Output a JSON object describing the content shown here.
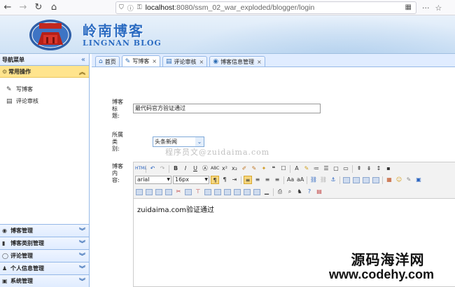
{
  "browser": {
    "url_host": "localhost",
    "url_rest": ":8080/ssm_02_war_exploded/blogger/login"
  },
  "banner": {
    "title_cn": "岭南博客",
    "title_en": "LINGNAN BLOG"
  },
  "sidebar": {
    "header": "导航菜单",
    "collapse_glyph": "«",
    "open_section": {
      "label": "常用操作",
      "items": [
        {
          "label": "写博客",
          "icon": "pencil-icon"
        },
        {
          "label": "评论审核",
          "icon": "comment-icon"
        }
      ]
    },
    "closed_sections": [
      {
        "label": "博客管理",
        "icon": "blog-icon"
      },
      {
        "label": "博客类别管理",
        "icon": "list-icon"
      },
      {
        "label": "评论管理",
        "icon": "comment-icon"
      },
      {
        "label": "个人信息管理",
        "icon": "user-icon"
      },
      {
        "label": "系统管理",
        "icon": "gear-icon"
      }
    ]
  },
  "tabs": [
    {
      "label": "首页",
      "icon": "home-icon",
      "closable": false,
      "active": false
    },
    {
      "label": "写博客",
      "icon": "pencil-icon",
      "closable": true,
      "active": true
    },
    {
      "label": "评论审核",
      "icon": "comment-icon",
      "closable": true,
      "active": false
    },
    {
      "label": "博客信息管理",
      "icon": "blog-icon",
      "closable": true,
      "active": false
    }
  ],
  "form": {
    "title_label": [
      "博客",
      "标",
      "题:"
    ],
    "title_value": "最代码官方验证通过",
    "category_label": [
      "所属",
      "类",
      "别:"
    ],
    "category_value": "头条新闻",
    "content_label": [
      "博客",
      "内",
      "容:"
    ],
    "font_family": "arial",
    "font_size": "16px",
    "content_text": "zuidaima.com验证通过"
  },
  "watermark_text": "程序员文@zuidaima.com",
  "site_watermark": {
    "line1": "源码海洋网",
    "line2": "www.codehy.com"
  },
  "colors": {
    "accent": "#2c6cc2",
    "panel_border": "#95b8e7",
    "selected_section": "#ffe48d"
  }
}
